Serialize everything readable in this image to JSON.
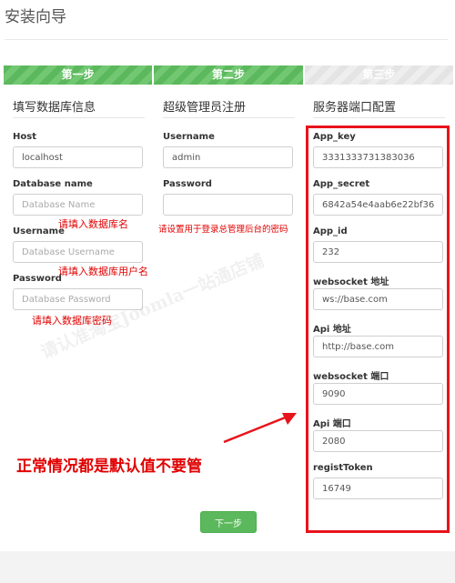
{
  "page": {
    "title": "安装向导"
  },
  "steps": [
    {
      "label": "第一步",
      "state": "done"
    },
    {
      "label": "第二步",
      "state": "done"
    },
    {
      "label": "第三步",
      "state": "todo"
    }
  ],
  "database": {
    "heading": "填写数据库信息",
    "host": {
      "label": "Host",
      "value": "localhost"
    },
    "name": {
      "label": "Database name",
      "placeholder": "Database Name"
    },
    "username": {
      "label": "Username",
      "placeholder": "Database Username"
    },
    "password": {
      "label": "Password",
      "placeholder": "Database Password"
    }
  },
  "admin": {
    "heading": "超级管理员注册",
    "username": {
      "label": "Username",
      "value": "admin"
    },
    "password": {
      "label": "Password",
      "value": ""
    }
  },
  "server": {
    "heading": "服务器端口配置",
    "app_key": {
      "label": "App_key",
      "value": "3331333731383036"
    },
    "app_secret": {
      "label": "App_secret",
      "value": "6842a54e4aab6e22bf368e5l"
    },
    "app_id": {
      "label": "App_id",
      "value": "232"
    },
    "ws_address": {
      "label": "websocket 地址",
      "value": "ws://base.com"
    },
    "api_address": {
      "label": "Api 地址",
      "value": "http://base.com"
    },
    "ws_port": {
      "label": "websocket 端口",
      "value": "9090"
    },
    "api_port": {
      "label": "Api 端口",
      "value": "2080"
    },
    "regist_token": {
      "label": "registToken",
      "value": "16749"
    }
  },
  "annotations": {
    "db_name": "请填入数据库名",
    "db_user": "请填入数据库用户名",
    "db_password": "请填入数据库密码",
    "admin_password": "请设置用于登录总管理后台的密码",
    "defaults": "正常情况都是默认值不要管",
    "watermark": "请认准淘宝Joomla一站通店铺",
    "highlight_color": "#e8131b"
  },
  "actions": {
    "next_label": "下一步"
  },
  "colors": {
    "accent": "#5cb85c",
    "annotation": "#e00000"
  }
}
